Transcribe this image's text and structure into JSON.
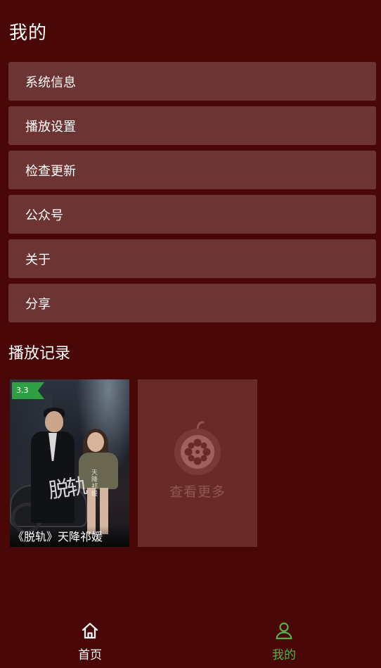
{
  "header": {
    "title": "我的"
  },
  "menu": {
    "items": [
      {
        "label": "系统信息"
      },
      {
        "label": "播放设置"
      },
      {
        "label": "检查更新"
      },
      {
        "label": "公众号"
      },
      {
        "label": "关于"
      },
      {
        "label": "分享"
      }
    ]
  },
  "history": {
    "title": "播放记录",
    "items": [
      {
        "title": "《脱轨》天降祁媛",
        "rating": "3.3",
        "poster_title_art": "脱轨",
        "poster_subtitle_art": "天降祁媛"
      }
    ],
    "more_label": "查看更多"
  },
  "bottom_nav": {
    "items": [
      {
        "label": "首页",
        "icon": "home-icon",
        "active": false
      },
      {
        "label": "我的",
        "icon": "user-icon",
        "active": true
      }
    ]
  },
  "colors": {
    "background": "#4a0707",
    "menu_item": "#6c3432",
    "more_card": "#6a2a29",
    "active": "#53b04a",
    "rating_badge": "#2ea043"
  }
}
